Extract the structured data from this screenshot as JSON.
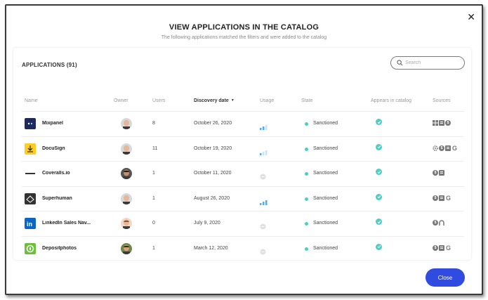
{
  "modal": {
    "title": "VIEW APPLICATIONS IN THE CATALOG",
    "subtitle": "The following applications matched the filters and were added to the catalog",
    "close_icon": "close-icon",
    "close_button_label": "Close"
  },
  "applications": {
    "count_label": "APPLICATIONS (91)",
    "search_placeholder": "Search",
    "columns": {
      "name": "Name",
      "owner": "Owner",
      "users": "Users",
      "discovery_date": "Discovery date",
      "usage": "Usage",
      "state": "State",
      "appears_in_catalog": "Appears in catalog",
      "sources": "Sources"
    },
    "rows": [
      {
        "name": "Mixpanel",
        "users": "8",
        "date": "October 26, 2020",
        "usage": "medium",
        "state": "Sanctioned",
        "in_catalog": true,
        "sources": [
          "windows-icon",
          "square-icon",
          "circle-icon"
        ],
        "logo_color": "#1f2a5c",
        "owner_avatar": "bald"
      },
      {
        "name": "DocuSign",
        "users": "11",
        "date": "October 19, 2020",
        "usage": "low",
        "state": "Sanctioned",
        "in_catalog": true,
        "sources": [
          "gear-icon",
          "circle-icon",
          "square-icon",
          "google-icon"
        ],
        "logo_color": "#ffcc22",
        "owner_avatar": "bald"
      },
      {
        "name": "Coveralls.io",
        "users": "1",
        "date": "October 11, 2020",
        "usage": "none",
        "state": "Sanctioned",
        "in_catalog": true,
        "sources": [
          "circle-icon",
          "square-icon"
        ],
        "logo_color": "#ffffff",
        "owner_avatar": "dark"
      },
      {
        "name": "Superhuman",
        "users": "1",
        "date": "August 26, 2020",
        "usage": "high",
        "state": "Sanctioned",
        "in_catalog": true,
        "sources": [
          "circle-icon",
          "square-icon",
          "google-icon"
        ],
        "logo_color": "#333333",
        "owner_avatar": "bald"
      },
      {
        "name": "LinkedIn Sales Nav...",
        "users": "0",
        "date": "July 9, 2020",
        "usage": "none",
        "state": "Sanctioned",
        "in_catalog": true,
        "sources": [
          "circle-icon",
          "arch-icon"
        ],
        "logo_color": "#0a66c2",
        "owner_avatar": "red"
      },
      {
        "name": "Depositphotos",
        "users": "1",
        "date": "March 12, 2020",
        "usage": "none",
        "state": "Sanctioned",
        "in_catalog": true,
        "sources": [
          "circle-icon",
          "square-icon",
          "google-icon"
        ],
        "logo_color": "#6cbf3a",
        "owner_avatar": "green"
      }
    ]
  },
  "colors": {
    "accent": "#2f4be0",
    "state_dot": "#4ecdc4",
    "usage_bar": "#5aa9f0"
  }
}
